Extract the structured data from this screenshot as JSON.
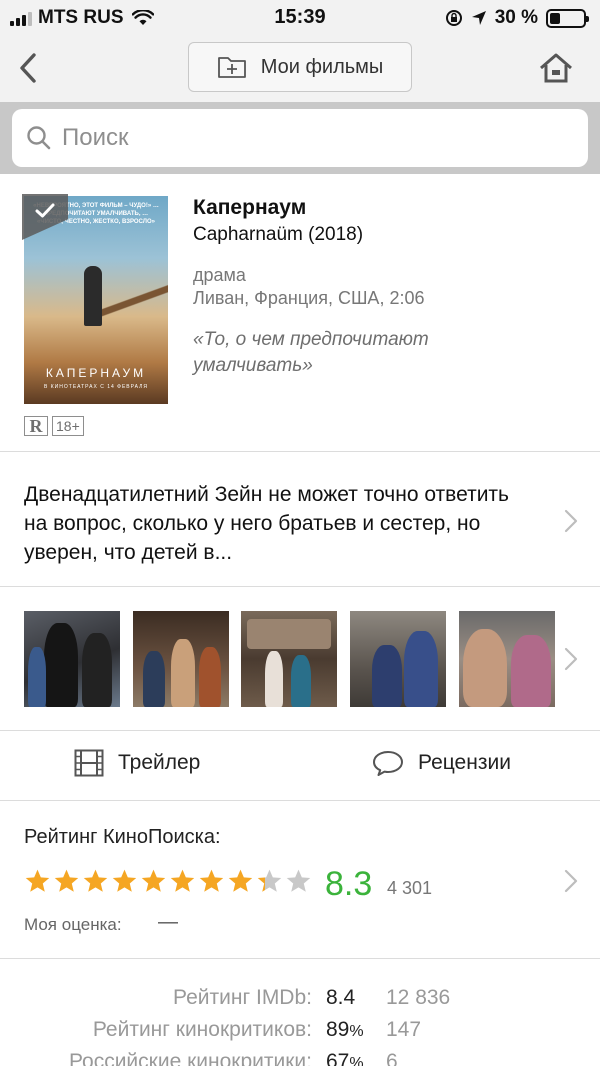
{
  "status_bar": {
    "carrier": "MTS RUS",
    "time": "15:39",
    "battery": "30 %",
    "battery_level": 0.3
  },
  "nav": {
    "my_films_label": "Мои фильмы",
    "icons": [
      "back-chevron-icon",
      "add-to-folder-icon",
      "home-icon"
    ]
  },
  "search": {
    "placeholder": "Поиск"
  },
  "movie": {
    "title": "Капернаум",
    "original_title": "Capharnaüm (2018)",
    "genre": "драма",
    "countries_duration": "Ливан, Франция, США, 2:06",
    "tagline": "«То, о чем предпочитают умалчивать»",
    "mpaa": "R",
    "age": "18+",
    "poster": {
      "top_text": "«НЕВЕРОЯТНО, ЭТОТ ФИЛЬМ – ЧУДО!» … ПРЕДПОЧИТАЮТ УМАЛЧИВАТЬ, … «ЧИСТО, ЧЕСТНО, ЖЕСТКО, ВЗРОСЛО»",
      "title": "КАПЕРНАУМ",
      "subtitle": "В КИНОТЕАТРАХ С 14 ФЕВРАЛЯ"
    }
  },
  "description": {
    "text": "Двенадцатилетний Зейн не может точно ответить на вопрос, сколько у него братьев и сестер, но уверен, что детей в..."
  },
  "stills": {
    "count": 5
  },
  "actions": {
    "trailer_label": "Трейлер",
    "reviews_label": "Рецензии"
  },
  "kinopoisk": {
    "label": "Рейтинг КиноПоиска:",
    "score": "8.3",
    "score_value": 8.3,
    "stars_max": 10,
    "votes": "4 301",
    "my_rating_label": "Моя оценка:",
    "my_rating_value": "—",
    "star_color": "#f5a623",
    "score_color": "#3bb33b"
  },
  "other_ratings": [
    {
      "label": "Рейтинг IMDb:",
      "value": "8.4",
      "suffix": "",
      "count": "12 836"
    },
    {
      "label": "Рейтинг кинокритиков:",
      "value": "89",
      "suffix": "%",
      "count": "147"
    },
    {
      "label": "Российские кинокритики:",
      "value": "67",
      "suffix": "%",
      "count": "6"
    }
  ]
}
